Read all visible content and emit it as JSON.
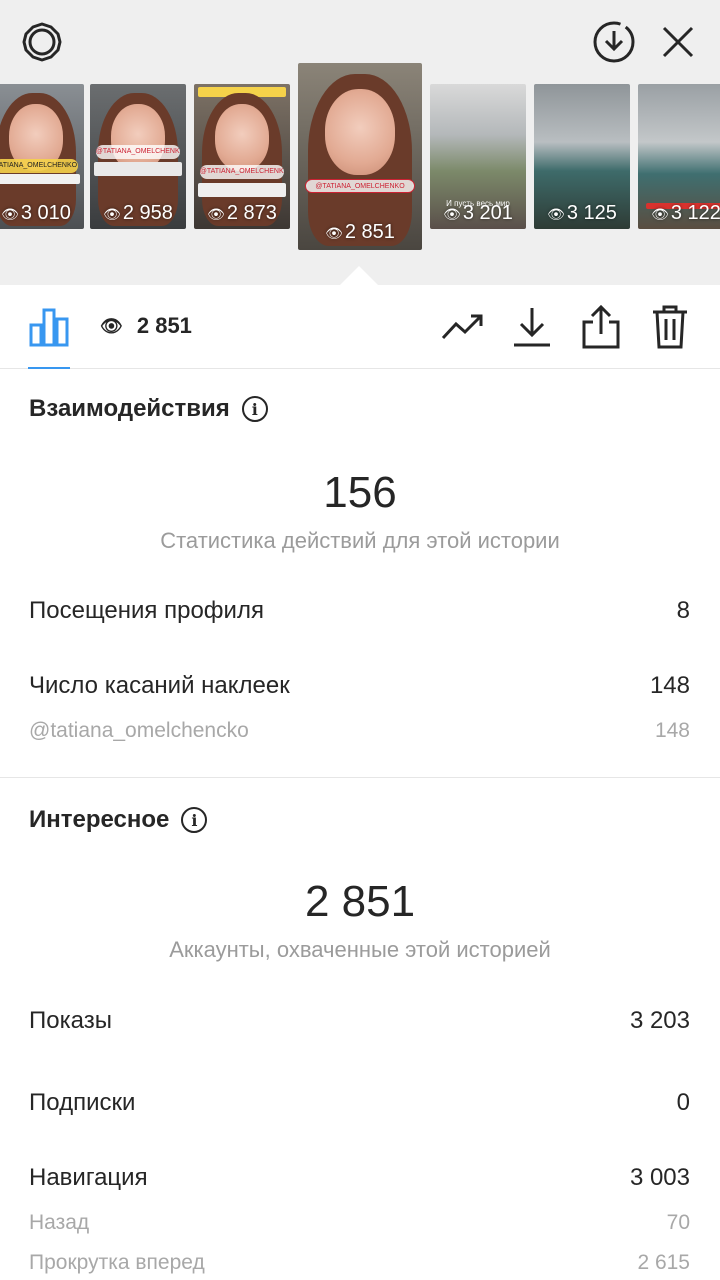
{
  "header": {
    "settings_icon": "gear-icon",
    "download_icon": "download-circle-icon",
    "close_icon": "close-icon"
  },
  "thumbnails": [
    {
      "views": "3 010",
      "caption": "TATIANA_OMELCHENKO"
    },
    {
      "views": "2 958",
      "caption": "@TATIANA_OMELCHENKO"
    },
    {
      "views": "2 873",
      "caption": "@TATIANA_OMELCHENKO"
    },
    {
      "views": "2 851",
      "caption": "@TATIANA_OMELCHENKO"
    },
    {
      "views": "3 201",
      "caption": "И пусть весь мир"
    },
    {
      "views": "3 125",
      "caption": ""
    },
    {
      "views": "3 122",
      "caption": ""
    }
  ],
  "toolbar": {
    "views": "2 851",
    "icons": [
      "bar-chart-icon",
      "eye-icon",
      "trend-icon",
      "download-icon",
      "share-icon",
      "trash-icon"
    ]
  },
  "interactions": {
    "title": "Взаимодействия",
    "total": "156",
    "caption": "Статистика действий для этой истории",
    "profile_visits_label": "Посещения профиля",
    "profile_visits_value": "8",
    "sticker_taps_label": "Число касаний наклеек",
    "sticker_taps_value": "148",
    "mention_label": "@tatiana_omelchencko",
    "mention_value": "148"
  },
  "discovery": {
    "title": "Интересное",
    "reach": "2 851",
    "caption": "Аккаунты, охваченные этой историей",
    "impressions_label": "Показы",
    "impressions_value": "3 203",
    "follows_label": "Подписки",
    "follows_value": "0",
    "navigation_label": "Навигация",
    "navigation_value": "3 003",
    "back_label": "Назад",
    "back_value": "70",
    "forward_label": "Прокрутка вперед",
    "forward_value": "2 615"
  },
  "colors": {
    "accent": "#3897f0",
    "muted": "#9b9b9b",
    "text": "#262626",
    "header_bg": "#efefef"
  }
}
